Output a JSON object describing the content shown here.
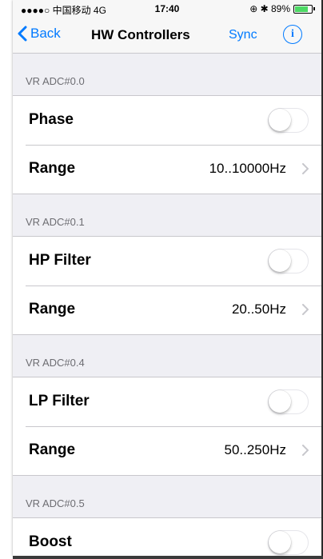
{
  "status_bar": {
    "carrier": "●●●●○ 中国移动  4G",
    "time": "17:40",
    "indicators": "⊕ ✱ 89%",
    "battery_level": 0.89
  },
  "nav": {
    "back_label": "Back",
    "title": "HW Controllers",
    "sync_label": "Sync",
    "info_glyph": "i"
  },
  "sections": [
    {
      "header": "VR ADC#0.0",
      "rows": [
        {
          "label": "Phase",
          "type": "toggle",
          "on": false
        },
        {
          "label": "Range",
          "type": "value",
          "value": "10..10000Hz"
        }
      ]
    },
    {
      "header": "VR ADC#0.1",
      "rows": [
        {
          "label": "HP Filter",
          "type": "toggle",
          "on": false
        },
        {
          "label": "Range",
          "type": "value",
          "value": "20..50Hz"
        }
      ]
    },
    {
      "header": "VR ADC#0.4",
      "rows": [
        {
          "label": "LP Filter",
          "type": "toggle",
          "on": false
        },
        {
          "label": "Range",
          "type": "value",
          "value": "50..250Hz"
        }
      ]
    },
    {
      "header": "VR ADC#0.5",
      "rows": [
        {
          "label": "Boost",
          "type": "toggle",
          "on": false
        }
      ]
    }
  ],
  "colors": {
    "accent": "#007aff",
    "background": "#efeff4",
    "separator": "#c8c7cc",
    "section_header_text": "#6d6d72"
  }
}
